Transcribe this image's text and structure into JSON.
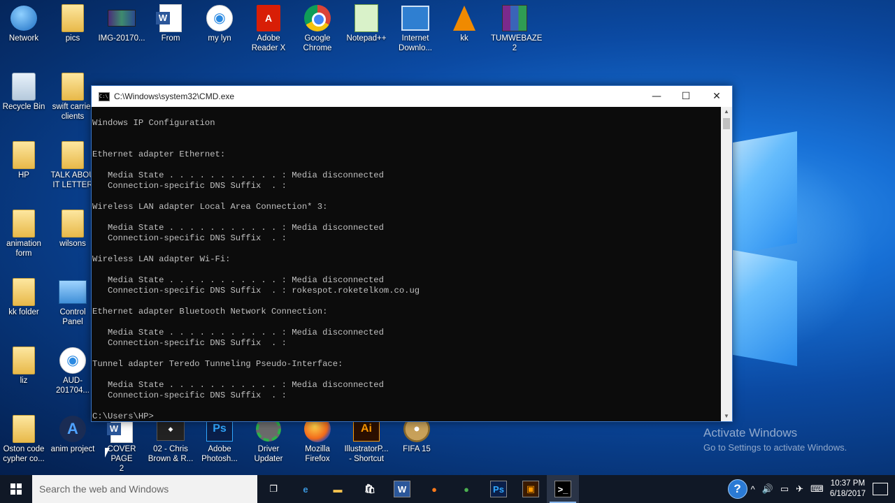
{
  "desktop": {
    "icons": [
      {
        "label": "Network",
        "kind": "network"
      },
      {
        "label": "pics",
        "kind": "folder"
      },
      {
        "label": "IMG-20170...",
        "kind": "image"
      },
      {
        "label": "From",
        "kind": "word"
      },
      {
        "label": "my lyn",
        "kind": "doc-ie"
      },
      {
        "label": "Adobe\nReader X",
        "kind": "pdf"
      },
      {
        "label": "Google\nChrome",
        "kind": "chrome"
      },
      {
        "label": "Notepad++",
        "kind": "notepad"
      },
      {
        "label": "Internet\nDownlo...",
        "kind": "idm"
      },
      {
        "label": "kk",
        "kind": "vlc"
      },
      {
        "label": "TUMWEBAZE\n2",
        "kind": "rar"
      },
      {
        "label": "Recycle Bin",
        "kind": "recycle"
      },
      {
        "label": "swift carrier\nclients",
        "kind": "folder"
      },
      {
        "label": "HP",
        "kind": "folder-user"
      },
      {
        "label": "TALK ABOU\nIT LETTER",
        "kind": "folder"
      },
      {
        "label": "animation\nform",
        "kind": "folder-word"
      },
      {
        "label": "wilsons",
        "kind": "folder"
      },
      {
        "label": "kk folder",
        "kind": "folder"
      },
      {
        "label": "Control\nPanel",
        "kind": "cpanel"
      },
      {
        "label": "liz",
        "kind": "folder"
      },
      {
        "label": "AUD-201704...",
        "kind": "doc-ie"
      },
      {
        "label": "Oston code\ncypher co...",
        "kind": "folder"
      },
      {
        "label": "anim project",
        "kind": "anim"
      },
      {
        "label": "COVER PAGE\n2",
        "kind": "word"
      },
      {
        "label": "02 - Chris\nBrown & R...",
        "kind": "video"
      },
      {
        "label": "Adobe\nPhotosh...",
        "kind": "ps"
      },
      {
        "label": "Driver\nUpdater",
        "kind": "gear"
      },
      {
        "label": "Mozilla\nFirefox",
        "kind": "firefox"
      },
      {
        "label": "IllustratorP...\n- Shortcut",
        "kind": "ai"
      },
      {
        "label": "FIFA 15",
        "kind": "disc"
      }
    ]
  },
  "cmd_window": {
    "title": "C:\\Windows\\system32\\CMD.exe",
    "controls": {
      "minimize": "—",
      "maximize": "☐",
      "close": "✕"
    },
    "lines": [
      "Windows IP Configuration",
      "",
      "",
      "Ethernet adapter Ethernet:",
      "",
      "   Media State . . . . . . . . . . . : Media disconnected",
      "   Connection-specific DNS Suffix  . :",
      "",
      "Wireless LAN adapter Local Area Connection* 3:",
      "",
      "   Media State . . . . . . . . . . . : Media disconnected",
      "   Connection-specific DNS Suffix  . :",
      "",
      "Wireless LAN adapter Wi-Fi:",
      "",
      "   Media State . . . . . . . . . . . : Media disconnected",
      "   Connection-specific DNS Suffix  . : rokespot.roketelkom.co.ug",
      "",
      "Ethernet adapter Bluetooth Network Connection:",
      "",
      "   Media State . . . . . . . . . . . : Media disconnected",
      "   Connection-specific DNS Suffix  . :",
      "",
      "Tunnel adapter Teredo Tunneling Pseudo-Interface:",
      "",
      "   Media State . . . . . . . . . . . : Media disconnected",
      "   Connection-specific DNS Suffix  . :",
      "",
      "C:\\Users\\HP>"
    ]
  },
  "watermark": {
    "title": "Activate Windows",
    "subtitle": "Go to Settings to activate Windows."
  },
  "taskbar": {
    "search_placeholder": "Search the web and Windows",
    "pinned": [
      {
        "name": "task-view",
        "glyph": "❐"
      },
      {
        "name": "edge",
        "glyph": "e"
      },
      {
        "name": "file-explorer",
        "glyph": "▬"
      },
      {
        "name": "store",
        "glyph": "🛍"
      },
      {
        "name": "word",
        "glyph": "W"
      },
      {
        "name": "firefox",
        "glyph": "●"
      },
      {
        "name": "chrome",
        "glyph": "●"
      },
      {
        "name": "photoshop",
        "glyph": "Ps"
      },
      {
        "name": "illustrator",
        "glyph": "▣"
      },
      {
        "name": "cmd",
        "glyph": ">_"
      }
    ],
    "tray": {
      "help": "?",
      "chevron": "^",
      "volume": "🔊",
      "battery": "▭",
      "network": "✈",
      "keyboard": "⌨",
      "time": "10:37 PM",
      "date": "6/18/2017"
    }
  },
  "colors": {
    "console_bg": "#0c0c0c",
    "console_text": "#c0c0c0",
    "taskbar_bg": "#101826",
    "accent": "#3a74c2"
  }
}
